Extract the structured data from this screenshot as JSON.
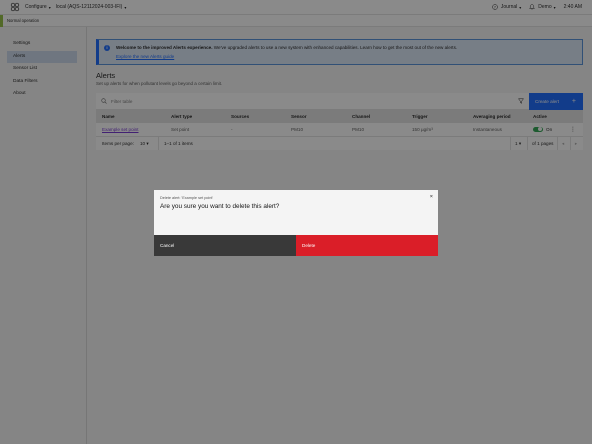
{
  "topbar": {
    "configure_label": "Configure",
    "device_label": "local (AQS-12112024-003-IFI)",
    "journal_label": "Journal",
    "user_label": "Demo",
    "time": "2:40 AM"
  },
  "status": {
    "text": "Normal operation",
    "accent_color": "#8fbc3a"
  },
  "sidebar": {
    "items": [
      {
        "label": "Settings"
      },
      {
        "label": "Alerts"
      },
      {
        "label": "Sensor List"
      },
      {
        "label": "Data Filters"
      },
      {
        "label": "About"
      }
    ]
  },
  "banner": {
    "title": "Welcome to the improved Alerts experience.",
    "message": " We've upgraded alerts to use a new system with enhanced capabilities. Learn how to get the most out of the new alerts.",
    "link": "Explore the new Alerts guide"
  },
  "alerts": {
    "title": "Alerts",
    "subtitle": "Set up alerts for when pollutant levels go beyond a certain limit.",
    "filter_placeholder": "Filter table",
    "create_label": "Create alert",
    "create_icon": "+",
    "columns": [
      "Name",
      "Alert type",
      "Sources",
      "Sensor",
      "Channel",
      "Trigger",
      "Averaging period",
      "Active"
    ],
    "row": {
      "name": "Example set point",
      "type": "Set point",
      "sources": "-",
      "sensor": "PM10",
      "channel": "PM10",
      "trigger": "150 µg/m³",
      "period": "Instantaneous",
      "active": "On"
    },
    "pager": {
      "items_per_page_label": "Items per page:",
      "items_per_page": "10",
      "range": "1–1 of 1 items",
      "page": "1",
      "of_pages": "of 1 pages"
    }
  },
  "modal": {
    "label": "Delete alert: 'Example set point'",
    "title": "Are you sure you want to delete this alert?",
    "cancel": "Cancel",
    "delete": "Delete",
    "delete_color": "#da1e28"
  }
}
